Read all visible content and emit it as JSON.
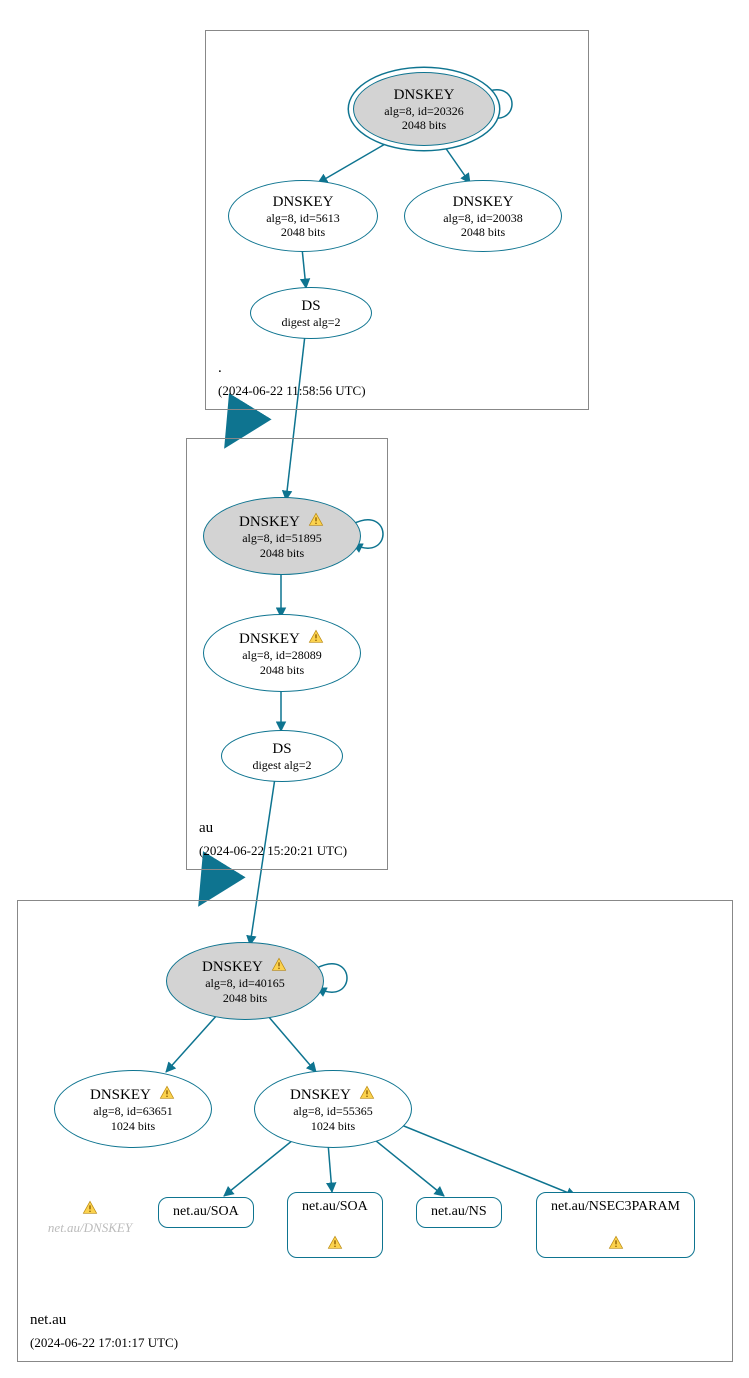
{
  "zones": {
    "root": {
      "name": ".",
      "time": "(2024-06-22 11:58:56 UTC)"
    },
    "au": {
      "name": "au",
      "time": "(2024-06-22 15:20:21 UTC)"
    },
    "netau": {
      "name": "net.au",
      "time": "(2024-06-22 17:01:17 UTC)"
    }
  },
  "nodes": {
    "root_ksk": {
      "title": "DNSKEY",
      "line1": "alg=8, id=20326",
      "line2": "2048 bits"
    },
    "root_zsk1": {
      "title": "DNSKEY",
      "line1": "alg=8, id=5613",
      "line2": "2048 bits"
    },
    "root_zsk2": {
      "title": "DNSKEY",
      "line1": "alg=8, id=20038",
      "line2": "2048 bits"
    },
    "root_ds": {
      "title": "DS",
      "line1": "digest alg=2"
    },
    "au_ksk": {
      "title": "DNSKEY",
      "line1": "alg=8, id=51895",
      "line2": "2048 bits",
      "warn": true
    },
    "au_zsk": {
      "title": "DNSKEY",
      "line1": "alg=8, id=28089",
      "line2": "2048 bits",
      "warn": true
    },
    "au_ds": {
      "title": "DS",
      "line1": "digest alg=2"
    },
    "netau_ksk": {
      "title": "DNSKEY",
      "line1": "alg=8, id=40165",
      "line2": "2048 bits",
      "warn": true
    },
    "netau_zsk1": {
      "title": "DNSKEY",
      "line1": "alg=8, id=63651",
      "line2": "1024 bits",
      "warn": true
    },
    "netau_zsk2": {
      "title": "DNSKEY",
      "line1": "alg=8, id=55365",
      "line2": "1024 bits",
      "warn": true
    },
    "rr_soa1": {
      "label": "net.au/SOA"
    },
    "rr_soa2": {
      "label": "net.au/SOA",
      "warn": true
    },
    "rr_ns": {
      "label": "net.au/NS"
    },
    "rr_nsec3": {
      "label": "net.au/NSEC3PARAM",
      "warn": true
    },
    "ghost": {
      "label": "net.au/DNSKEY"
    }
  }
}
